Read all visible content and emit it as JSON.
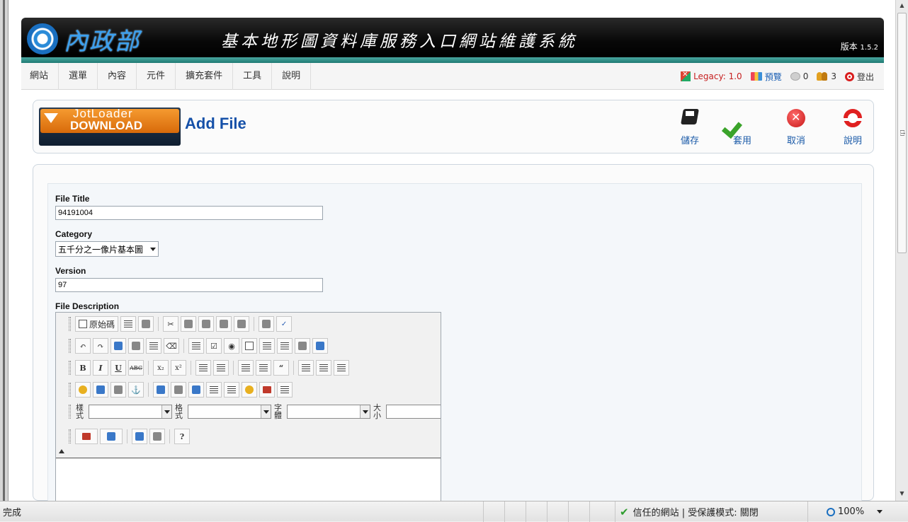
{
  "header": {
    "logo_text": "內政部",
    "system_title": "基本地形圖資料庫服務入口網站維護系統",
    "version_label": "版本",
    "version_number": "1.5.2"
  },
  "menu": {
    "items": [
      "網站",
      "選單",
      "內容",
      "元件",
      "擴充套件",
      "工具",
      "說明"
    ]
  },
  "status": {
    "legacy": "Legacy: 1.0",
    "preview": "預覽",
    "messages": "0",
    "users": "3",
    "logout": "登出"
  },
  "toolbar": {
    "logo_line1": "JotLoader",
    "logo_line2": "DOWNLOAD",
    "page_title": "Add File",
    "save": "儲存",
    "apply": "套用",
    "cancel": "取消",
    "help": "說明"
  },
  "form": {
    "file_title_label": "File Title",
    "file_title_value": "94191004",
    "category_label": "Category",
    "category_value": "五千分之一像片基本圖",
    "version_label": "Version",
    "version_value": "97",
    "description_label": "File Description"
  },
  "editor": {
    "source_button": "原始碼",
    "style_label": "樣式",
    "format_label": "格式",
    "font_label": "字體",
    "size_label": "大小"
  },
  "statusbar": {
    "done": "完成",
    "trusted": "信任的網站 | 受保護模式: 關閉",
    "zoom": "100%"
  }
}
